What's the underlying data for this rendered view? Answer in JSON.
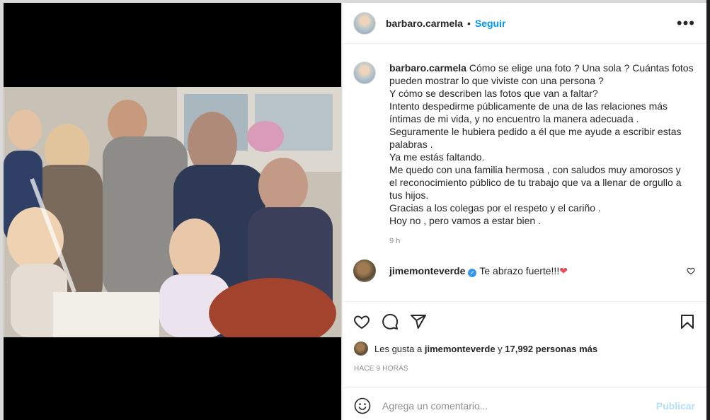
{
  "post": {
    "username": "barbaro.carmela",
    "separator": "•",
    "follow_label": "Seguir",
    "more_label": "•••",
    "caption_lines": [
      "Cómo se elige una foto ? Una sola ? Cuántas fotos",
      "pueden mostrar lo que viviste con una persona ?",
      "Y cómo se describen las fotos que van a faltar?",
      "Intento despedirme públicamente de una de las relaciones más",
      "íntimas de mi vida, y no encuentro la manera adecuada .",
      "Seguramente le hubiera pedido a él que me ayude a escribir estas",
      "palabras .",
      "Ya me estás faltando.",
      "Me quedo con una familia hermosa , con saludos muy amorosos y",
      "el reconocimiento público de tu trabajo que va a llenar de orgullo a",
      "tus hijos.",
      "Gracias a los colegas por el respeto y el cariño .",
      "Hoy no , pero vamos a estar bien ."
    ],
    "caption_time": "9 h"
  },
  "comment": {
    "username": "jimemonteverde",
    "verified_mark": "✓",
    "text": "Te abrazo fuerte!!!",
    "emoji": "❤",
    "like_icon": "heart-outline-icon"
  },
  "actions": {
    "icons": [
      "heart-icon",
      "comment-icon",
      "share-icon",
      "bookmark-icon"
    ]
  },
  "likes": {
    "prefix": "Les gusta a",
    "user": "jimemonteverde",
    "connector": "y",
    "count_text": "17,992 personas más"
  },
  "time_ago": "HACE 9 HORAS",
  "composer": {
    "placeholder": "Agrega un comentario...",
    "post_label": "Publicar",
    "emoji_icon": "smiley-icon"
  },
  "colors": {
    "accent": "#0095f6",
    "post_disabled": "#b2dffc",
    "secondary_text": "#8e8e8e"
  }
}
